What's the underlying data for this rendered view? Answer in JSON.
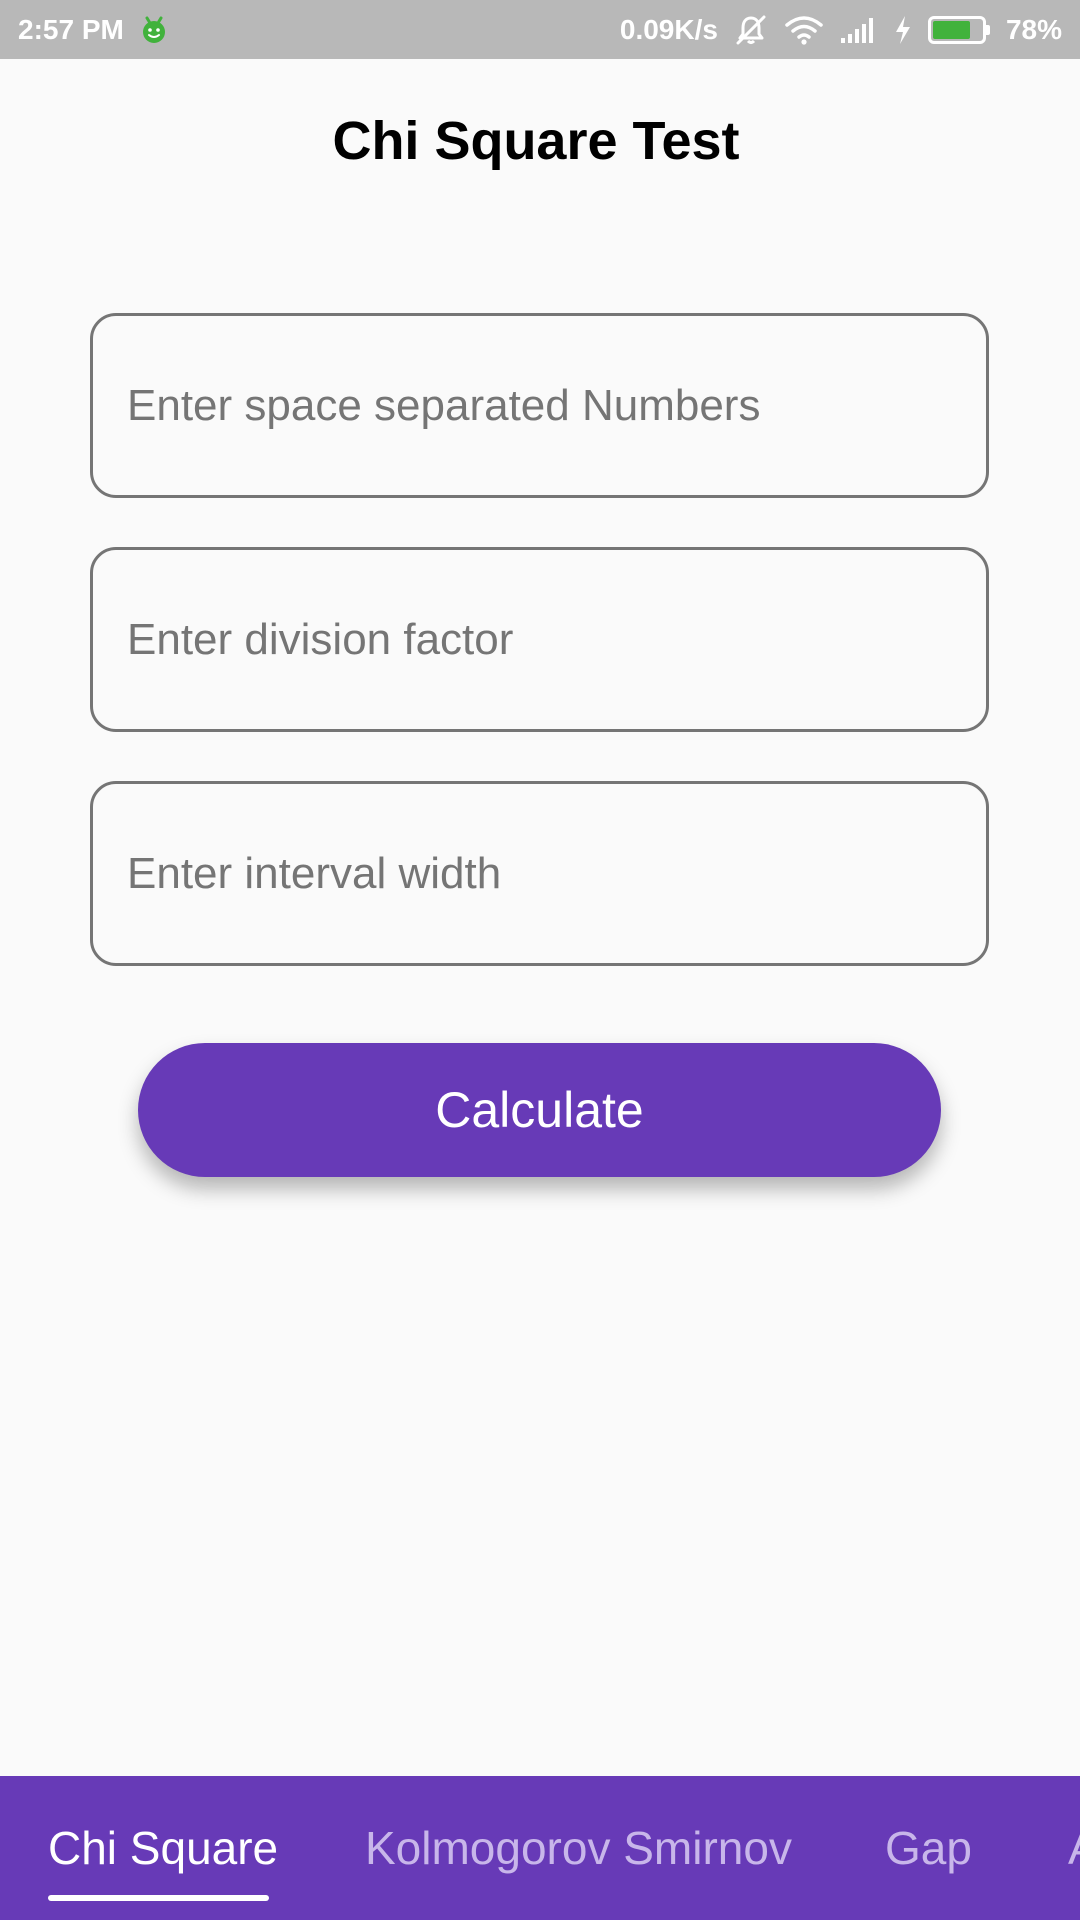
{
  "status_bar": {
    "time": "2:57 PM",
    "network_speed": "0.09K/s",
    "battery_percent": "78%",
    "battery_level": 0.78,
    "battery_color": "#41b23c",
    "icons": [
      "android-icon",
      "mute-icon",
      "wifi-icon",
      "signal-icon",
      "charging-icon",
      "battery-icon"
    ]
  },
  "page": {
    "title": "Chi Square Test"
  },
  "form": {
    "numbers_placeholder": "Enter space separated Numbers",
    "numbers_value": "",
    "division_placeholder": "Enter division factor",
    "division_value": "",
    "interval_placeholder": "Enter interval width",
    "interval_value": "",
    "calculate_label": "Calculate"
  },
  "tabs": {
    "items": [
      {
        "label": "Chi Square",
        "active": true
      },
      {
        "label": "Kolmogorov Smirnov",
        "active": false
      },
      {
        "label": "Gap",
        "active": false
      },
      {
        "label": "A",
        "active": false
      }
    ]
  },
  "colors": {
    "accent": "#673ab7",
    "status_bar": "#b8b8b8",
    "background": "#fafafa",
    "inactive_tab_text": "#c8b6ea"
  }
}
